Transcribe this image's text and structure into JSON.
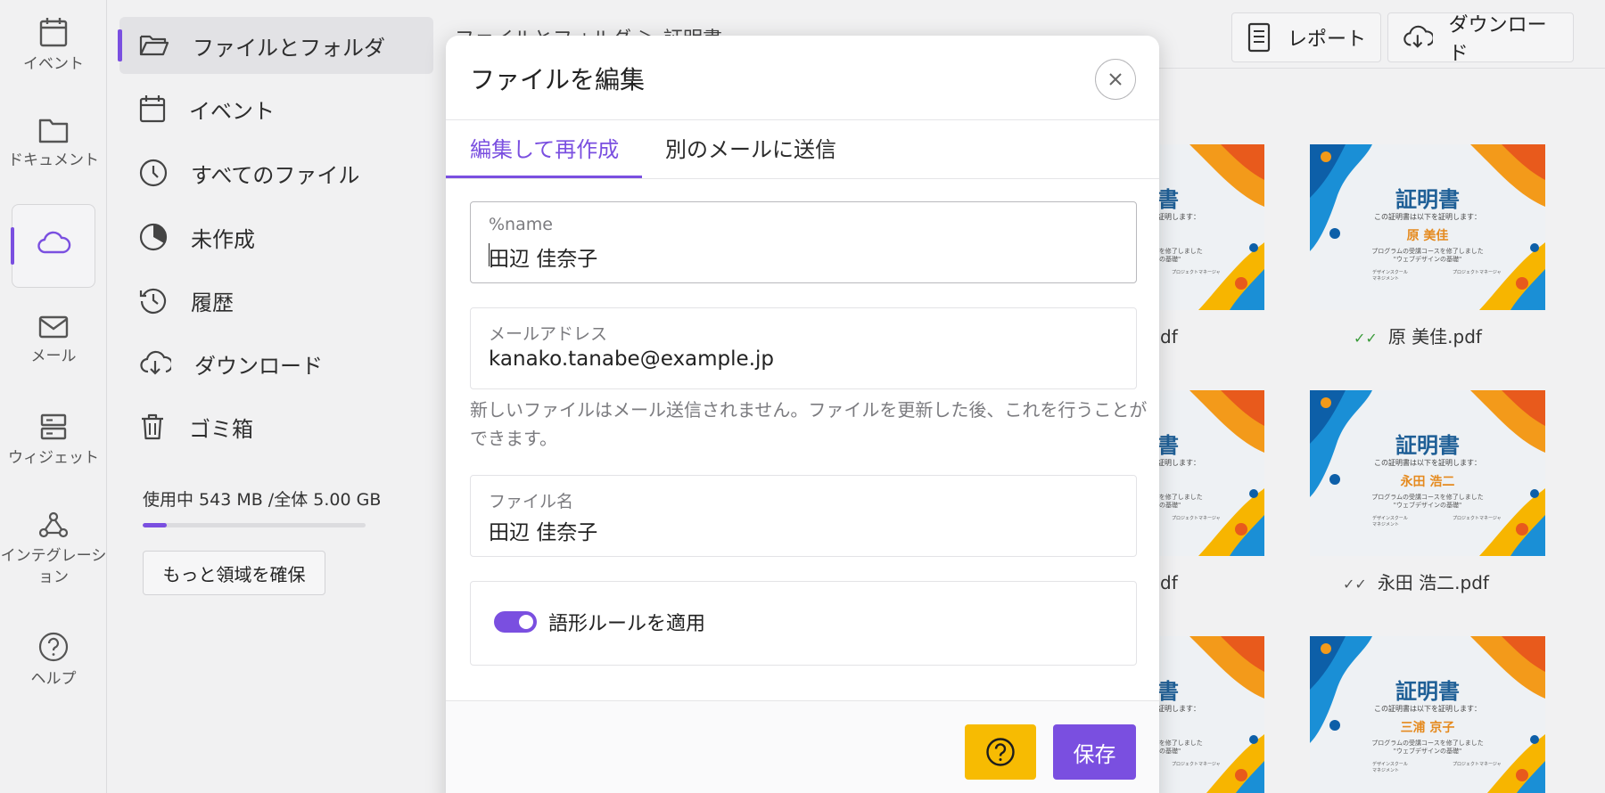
{
  "rail": {
    "items": [
      {
        "label": "イベント",
        "icon": "calendar-icon"
      },
      {
        "label": "ドキュメント",
        "icon": "folder-icon"
      },
      {
        "label": "",
        "icon": "cloud-icon",
        "active": true
      },
      {
        "label": "メール",
        "icon": "mail-icon"
      },
      {
        "label": "ウィジェット",
        "icon": "widget-icon"
      },
      {
        "label": "インテグレーション",
        "icon": "webhook-icon"
      },
      {
        "label": "ヘルプ",
        "icon": "help-circle-icon"
      }
    ]
  },
  "sidebar": {
    "items": [
      {
        "label": "ファイルとフォルダ",
        "icon": "folder-open-icon",
        "active": true
      },
      {
        "label": "イベント",
        "icon": "calendar-icon"
      },
      {
        "label": "すべてのファイル",
        "icon": "clock-icon"
      },
      {
        "label": "未作成",
        "icon": "pie-icon"
      },
      {
        "label": "履歴",
        "icon": "history-icon"
      },
      {
        "label": "ダウンロード",
        "icon": "cloud-download-icon"
      },
      {
        "label": "ゴミ箱",
        "icon": "trash-icon"
      }
    ],
    "usage": {
      "text": "使用中 543 MB /全体 5.00 GB",
      "fraction": 0.109
    },
    "more_space_label": "もっと領域を確保"
  },
  "header": {
    "breadcrumb": "ファイルとフォルダ ＞ 証明書",
    "report_label": "レポート",
    "download_label": "ダウンロード"
  },
  "files": [
    {
      "caption": "券.pdf",
      "cert_name": "",
      "sent": false
    },
    {
      "caption": "原 美佳.pdf",
      "cert_name": "原 美佳",
      "sent": true
    },
    {
      "caption": "気.pdf",
      "cert_name": "",
      "sent": false
    },
    {
      "caption": "永田 浩二.pdf",
      "cert_name": "永田 浩二",
      "sent": true
    },
    {
      "caption": "",
      "cert_name": "",
      "sent": false
    },
    {
      "caption": "",
      "cert_name": "三浦 京子",
      "sent": false
    }
  ],
  "certificate": {
    "title": "証明書",
    "subtitle": "この証明書は以下を証明します：",
    "body_line1": "プログラムの受講コースを修了しました",
    "body_line2": "\"ウェブデザインの基礎\"",
    "sig_left": "デザインスクール\nマネジメント",
    "sig_right": "プロジェクトマネージャ"
  },
  "modal": {
    "title": "ファイルを編集",
    "tabs": [
      {
        "label": "編集して再作成",
        "active": true
      },
      {
        "label": "別のメールに送信",
        "active": false
      }
    ],
    "fields": {
      "name": {
        "label": "%name",
        "value": "田辺 佳奈子"
      },
      "email": {
        "label": "メールアドレス",
        "value": "kanako.tanabe@example.jp"
      },
      "filename": {
        "label": "ファイル名",
        "value": "田辺 佳奈子"
      }
    },
    "hint": "新しいファイルはメール送信されません。ファイルを更新した後、これを行うことができます。",
    "toggle": {
      "label": "語形ルールを適用",
      "on": true
    },
    "save_label": "保存",
    "help_icon": "question-icon",
    "colors": {
      "accent": "#7a4fe0",
      "help_button": "#f7bb02"
    }
  }
}
